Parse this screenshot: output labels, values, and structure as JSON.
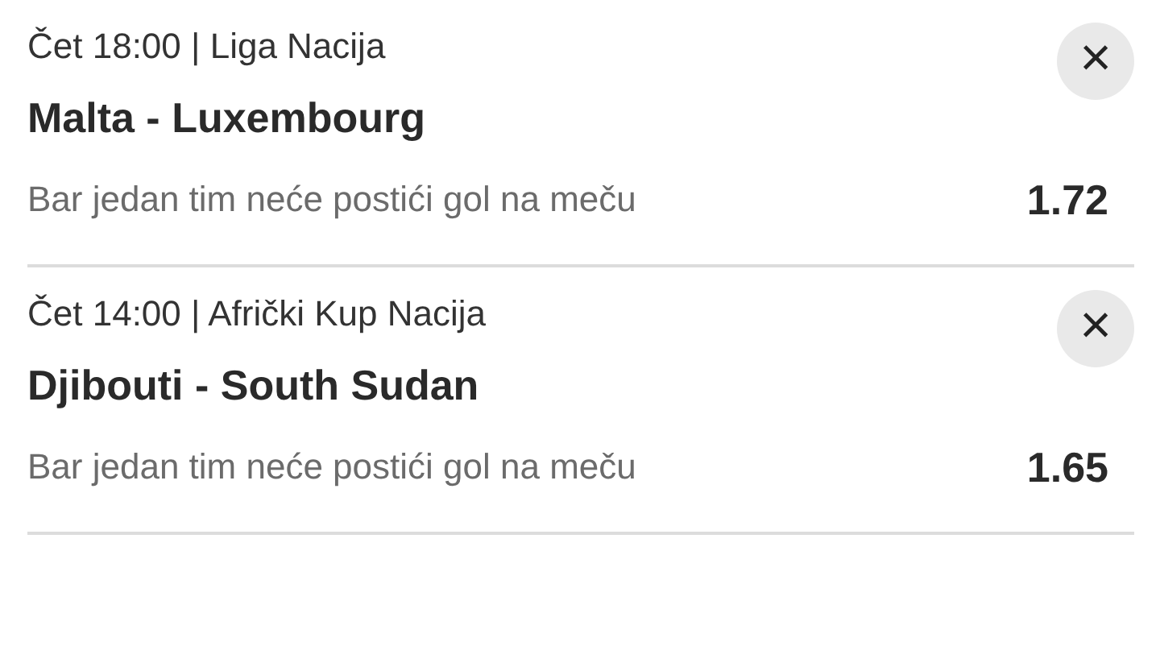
{
  "bets": [
    {
      "time": "Čet 18:00",
      "separator": "|",
      "league": "Liga Nacija",
      "match": "Malta - Luxembourg",
      "market": "Bar jedan tim neće postići gol na meču",
      "odds": "1.72",
      "close": "×"
    },
    {
      "time": "Čet 14:00",
      "separator": "|",
      "league": "Afrički Kup Nacija",
      "match": "Djibouti - South Sudan",
      "market": "Bar jedan tim neće postići gol na meču",
      "odds": "1.65",
      "close": "×"
    }
  ]
}
